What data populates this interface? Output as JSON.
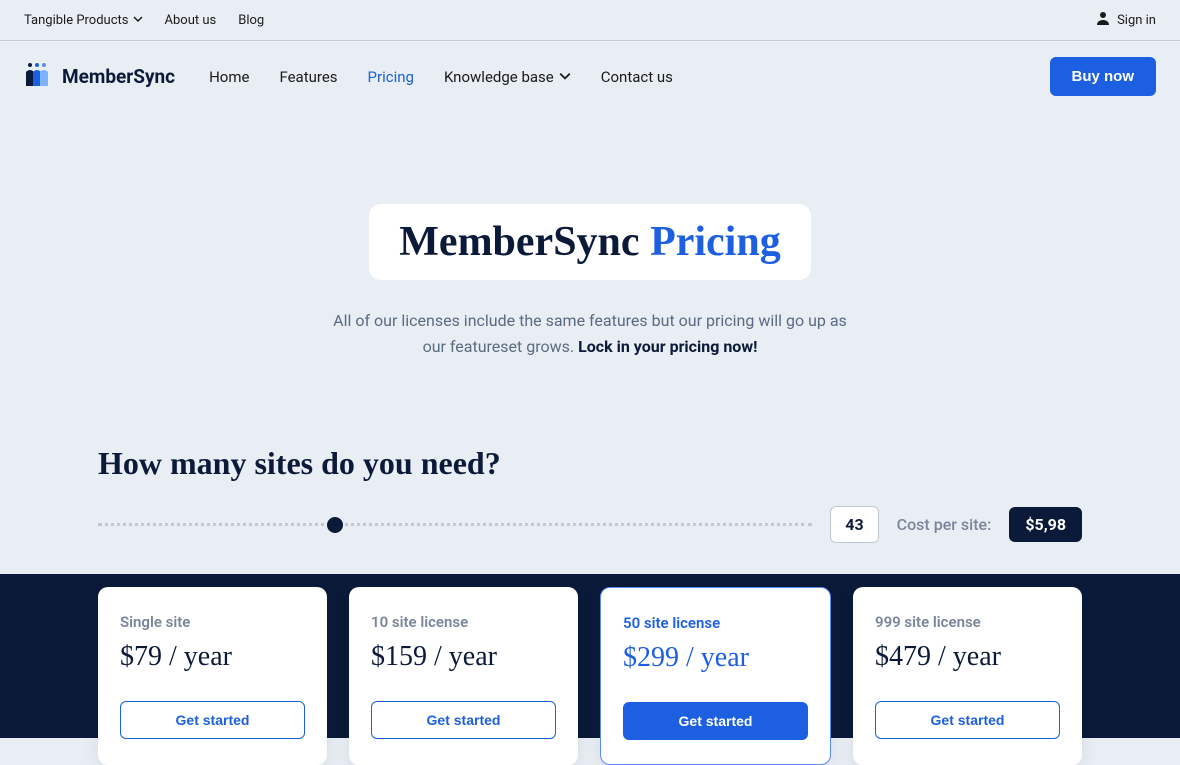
{
  "topbar": {
    "items": [
      "Tangible Products",
      "About us",
      "Blog"
    ],
    "signin": "Sign in"
  },
  "logo": "MemberSync",
  "nav": {
    "items": [
      "Home",
      "Features",
      "Pricing",
      "Knowledge base",
      "Contact us"
    ],
    "active_index": 2,
    "buy": "Buy now"
  },
  "hero": {
    "title_a": "MemberSync",
    "title_b": "Pricing",
    "sub_a": "All of our licenses include the same features but our pricing will go up as our featureset grows.  ",
    "sub_b": "Lock in your pricing now!"
  },
  "sites": {
    "heading": "How many sites do you need?",
    "count": "43",
    "cost_label": "Cost per site:",
    "cost_value": "$5,98"
  },
  "plans": [
    {
      "title": "Single site",
      "price": "$79 / year",
      "cta": "Get started",
      "highlight": false
    },
    {
      "title": "10 site license",
      "price": "$159 / year",
      "cta": "Get started",
      "highlight": false
    },
    {
      "title": "50 site license",
      "price": "$299 / year",
      "cta": "Get started",
      "highlight": true
    },
    {
      "title": "999 site license",
      "price": "$479 / year",
      "cta": "Get started",
      "highlight": false
    }
  ]
}
